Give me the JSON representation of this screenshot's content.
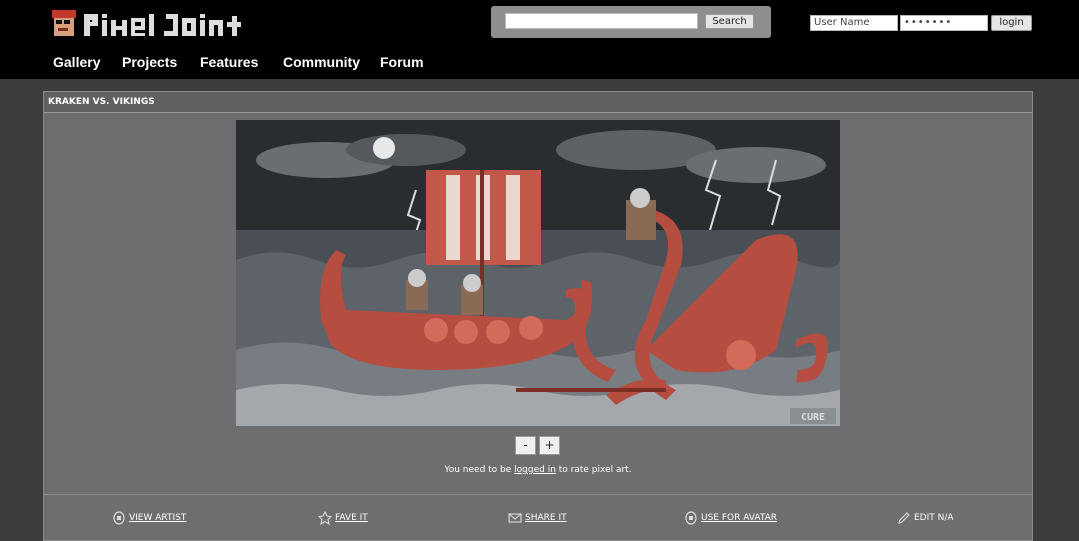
{
  "header": {
    "logo_text": "PiXEL JOiNT",
    "search": {
      "value": "",
      "button_label": "Search"
    },
    "login": {
      "username_placeholder": "User Name",
      "password_value": "•••••••",
      "button_label": "login"
    }
  },
  "nav": {
    "items": [
      {
        "label": "Gallery"
      },
      {
        "label": "Projects"
      },
      {
        "label": "Features"
      },
      {
        "label": "Community"
      },
      {
        "label": "Forum"
      }
    ]
  },
  "artwork": {
    "title": "KRAKEN VS. VIKINGS",
    "signature": "CURE",
    "zoom_out_label": "-",
    "zoom_in_label": "+"
  },
  "rating": {
    "prefix": "You need to be ",
    "link": "logged in",
    "suffix": " to rate pixel art."
  },
  "actions": [
    {
      "label": "VIEW ARTIST",
      "icon": "artist-icon"
    },
    {
      "label": "FAVE IT",
      "icon": "star-icon"
    },
    {
      "label": "SHARE IT",
      "icon": "envelope-icon"
    },
    {
      "label": "USE FOR AVATAR",
      "icon": "avatar-icon"
    },
    {
      "label": "EDIT N/A",
      "icon": "pencil-icon"
    }
  ],
  "colors": {
    "header_bg": "#000000",
    "page_bg": "#3a3d3b",
    "panel_bg": "#6e6e70",
    "boat_red": "#c2584a",
    "sea": "#4a4f55"
  }
}
